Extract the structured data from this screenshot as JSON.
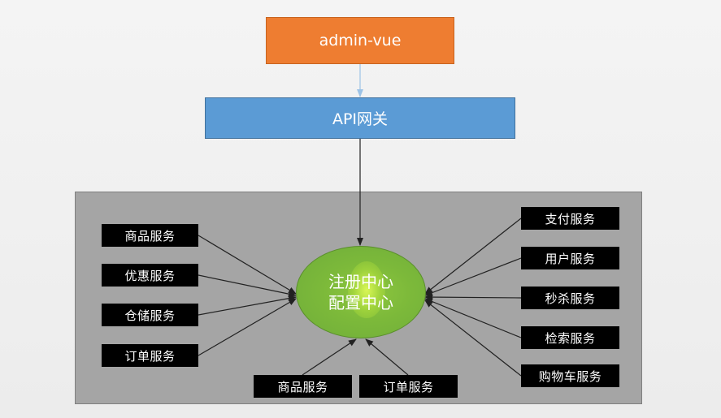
{
  "client": {
    "label": "admin-vue"
  },
  "gateway": {
    "label": "API网关"
  },
  "hub": {
    "line1": "注册中心",
    "line2": "配置中心"
  },
  "left_services": [
    "商品服务",
    "优惠服务",
    "仓储服务",
    "订单服务"
  ],
  "right_services": [
    "支付服务",
    "用户服务",
    "秒杀服务",
    "检索服务",
    "购物车服务"
  ],
  "bottom_services": [
    "商品服务",
    "订单服务"
  ],
  "colors": {
    "client": "#ee7d31",
    "gateway": "#5b9bd5",
    "panel": "#a5a5a5",
    "hub": "#7cb93a",
    "service": "#000000",
    "arrow_top": "#9dc3e6",
    "arrow": "#222222"
  }
}
